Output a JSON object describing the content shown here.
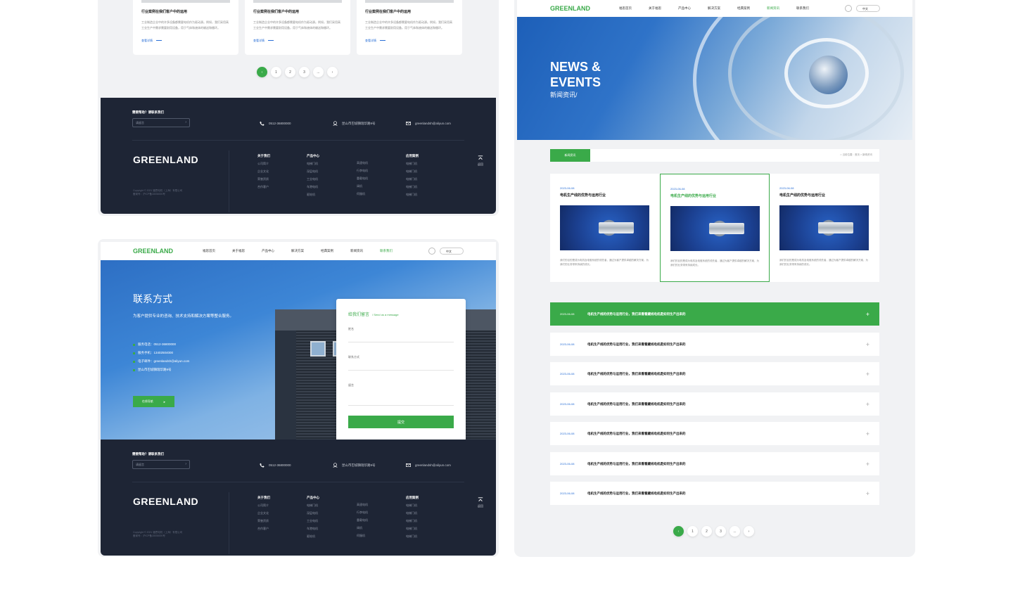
{
  "brand": "GREENLAND",
  "nav": {
    "items": [
      "福思首页",
      "关于福思",
      "产品中心",
      "解决方案",
      "经典案例",
      "新闻资讯",
      "联系我们"
    ],
    "lang": "中文"
  },
  "cases": {
    "cards": [
      {
        "title": "行业案例在我们客户中的运用",
        "desc": "工业制造企业中的许多设备都需要电机作为驱动源。例如，我们采用高工业生产中需求需要耐用设备，用于气体和液体的输送和循环。",
        "more": "查看详情"
      },
      {
        "title": "行业案例在我们客户中的运用",
        "desc": "工业制造企业中的许多设备都需要电机作为驱动源。例如，我们采用高工业生产中需求需要耐用设备，用于气体和液体的输送和循环。",
        "more": "查看详情"
      },
      {
        "title": "行业案例在我们客户中的运用",
        "desc": "工业制造企业中的许多设备都需要电机作为驱动源。例如，我们采用高工业生产中需求需要耐用设备，用于气体和液体的输送和循环。",
        "more": "查看详情"
      }
    ]
  },
  "pager": [
    "‹",
    "1",
    "2",
    "3",
    "...",
    "›"
  ],
  "footer": {
    "need": "需要帮助？请联系我们",
    "sub_placeholder": "请留言",
    "sub_arrow": "›",
    "phone": "0512-36800000",
    "address": "昆山市巴城镇瑞华路9号",
    "email": "greenlandsh@aliyun.com",
    "copy1": "Copyright © 2021 福思电机（上海）有限公司",
    "copy2": "备案号：沪ICP备18036000号",
    "top": "返回",
    "cols": [
      {
        "title": "关于我们",
        "items": [
          "公司简介",
          "企业文化",
          "荣誉资质",
          "合作客户"
        ]
      },
      {
        "title": "产品中心",
        "items": [
          "电梯门机",
          "深层电机",
          "工业电机",
          "车港电机",
          "驱轮机"
        ]
      },
      {
        "title": "",
        "items": [
          "高速电机",
          "行李电机",
          "重载电机",
          "阀机",
          "伺服机"
        ]
      },
      {
        "title": "应用案例",
        "items": [
          "电梯门机",
          "电梯门机",
          "电梯门机",
          "电梯门机",
          "电梯门机"
        ]
      }
    ]
  },
  "contact": {
    "title": "联系方式",
    "desc": "为客户提供专业的咨询、技术支持和解决方案等整合服务。",
    "info": [
      "服务电话：0512-36800000",
      "服务手机：13402504000",
      "电子邮件：greenlandsh@aliyun.com",
      "昆山市巴城镇瑞华路9号"
    ],
    "btn": "在线导航",
    "form": {
      "title": "给我们留言",
      "sub": "/ Send us a message",
      "f1": "姓名",
      "f2": "联系方式",
      "f3": "留言",
      "submit": "提交"
    }
  },
  "news": {
    "hero_en": "NEWS &",
    "hero_en2": "EVENTS",
    "hero_cn": "新闻资讯/",
    "tab": "新闻资讯",
    "crumb": "当前位置：首页 > 新闻资讯",
    "cards": [
      {
        "date": "2023-06-08",
        "title": "电机生产线的优势与运用行业",
        "desc": "我们的目的是成为电机及电驱系统的领先者，通过为客户提供卓越的解决方案，为我们的业务带来持续的成长。"
      },
      {
        "date": "2023-06-08",
        "title": "电机生产线的优势与运用行业",
        "desc": "我们的目的是成为电机及电驱系统的领先者，通过为客户提供卓越的解决方案，为我们的业务带来持续成长。"
      },
      {
        "date": "2023-06-08",
        "title": "电机生产线的优势与运用行业",
        "desc": "我们的目的是成为电机及电驱系统的领先者，通过为客户提供卓越的解决方案，为我们的业务带来持续的成长。"
      }
    ],
    "rows": [
      {
        "date": "2023-06-08",
        "title": "电机生产线的优势与运用行业，我们来看看藏线电机是如何生产出来的"
      },
      {
        "date": "2023-06-08",
        "title": "电机生产线的优势与运用行业，我们来看看藏线电机是如何生产出来的"
      },
      {
        "date": "2023-06-08",
        "title": "电机生产线的优势与运用行业，我们来看看藏线电机是如何生产出来的"
      },
      {
        "date": "2023-06-08",
        "title": "电机生产线的优势与运用行业，我们来看看藏线电机是如何生产出来的"
      },
      {
        "date": "2023-06-08",
        "title": "电机生产线的优势与运用行业，我们来看看藏线电机是如何生产出来的"
      },
      {
        "date": "2023-06-08",
        "title": "电机生产线的优势与运用行业，我们来看看藏线电机是如何生产出来的"
      },
      {
        "date": "2023-06-08",
        "title": "电机生产线的优势与运用行业，我们来看看藏线电机是如何生产出来的"
      }
    ],
    "plus": "+"
  },
  "colors": {
    "accent": "#3aaa49",
    "footer": "#1e2535",
    "link": "#2a6fd6"
  }
}
